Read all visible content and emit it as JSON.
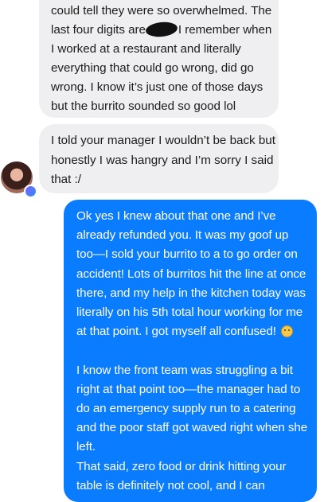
{
  "conversation": {
    "messages": [
      {
        "sender": "other",
        "lines": [
          "could tell they were so overwhelmed. The",
          "last four digits are",
          "I remember when",
          "I worked at a restaurant and literally",
          "everything that could go wrong, did go",
          "wrong. I know it’s just one of those days",
          "but the burrito sounded so good lol"
        ]
      },
      {
        "sender": "other",
        "lines": [
          "I told your manager I wouldn’t be back but",
          "honestly I was hangry and I’m sorry I said",
          "that :/"
        ]
      },
      {
        "sender": "me",
        "lines": [
          "Ok yes I knew about that one and I’ve",
          "already refunded you. It was my goof up",
          "too—I sold your burrito to a to go order on",
          "accident! Lots of burritos hit the line at once",
          "there, and my help in the kitchen today was",
          "literally on his 5th total hour working for me",
          "at that point. I got myself all confused!",
          "I know the front team was struggling a bit",
          "right at that point too—the manager had to",
          "do an emergency supply run to a catering",
          "and the poor staff got waved right when she",
          "left.",
          "That said, zero food or drink hitting your",
          "table is definitely not cool, and I can"
        ],
        "emoji": "sad-face-emoji"
      }
    ],
    "avatar_icon": "user-avatar-photo",
    "badge_icon": "messenger-badge-icon",
    "colors": {
      "incoming_bubble": "#efeff1",
      "outgoing_bubble": "#0a7cff",
      "incoming_text": "#1c1c1c",
      "outgoing_text": "#ffffff"
    }
  }
}
